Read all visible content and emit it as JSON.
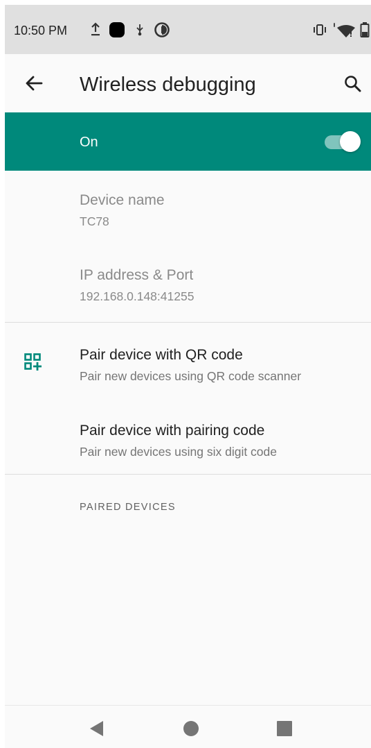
{
  "status_bar": {
    "time": "10:50 PM",
    "left_icons": [
      "upload-icon",
      "app-notification-icon",
      "usb-debugging-icon",
      "data-saver-icon"
    ],
    "right_icons": [
      "vibrate-icon",
      "wifi-icon",
      "battery-icon"
    ]
  },
  "app_bar": {
    "back_icon": "arrow-back-icon",
    "title": "Wireless debugging",
    "search_icon": "search-icon"
  },
  "master_switch": {
    "label": "On",
    "checked": true,
    "background_color": "#00897b"
  },
  "items": [
    {
      "title": "Device name",
      "summary": "TC78",
      "enabled": false
    },
    {
      "title": "IP address & Port",
      "summary": "192.168.0.148:41255",
      "enabled": false
    },
    {
      "icon": "qr-code-add-icon",
      "title": "Pair device with QR code",
      "summary": "Pair new devices using QR code scanner",
      "enabled": true
    },
    {
      "title": "Pair device with pairing code",
      "summary": "Pair new devices using six digit code",
      "enabled": true
    }
  ],
  "paired_devices_header": "PAIRED DEVICES",
  "nav_bar": {
    "back_icon": "nav-back-icon",
    "home_icon": "nav-home-icon",
    "recents_icon": "nav-recents-icon"
  }
}
